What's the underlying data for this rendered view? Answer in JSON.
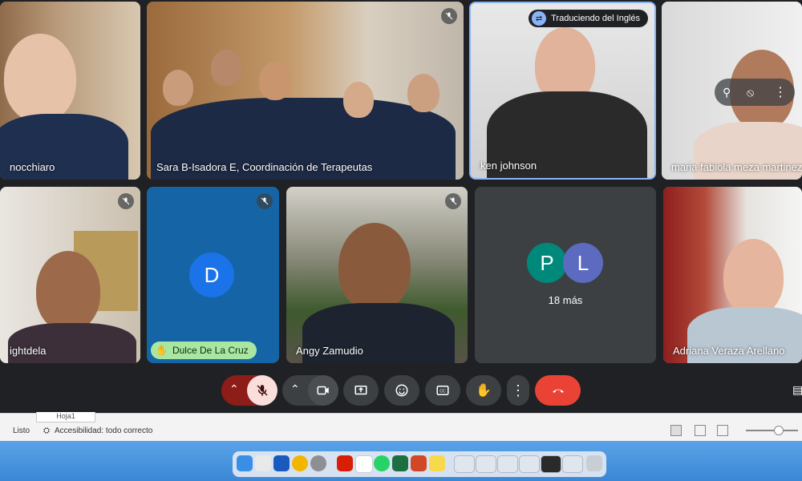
{
  "meeting": {
    "participants": [
      {
        "name": "nocchiaro"
      },
      {
        "name": "Sara B-Isadora E, Coordinación de Terapeutas"
      },
      {
        "name": "ken johnson",
        "badge": "Traduciendo del Inglés"
      },
      {
        "name": "maria fabiola meza martinez"
      },
      {
        "name": "ightdela"
      },
      {
        "name": "Dulce De La Cruz",
        "avatar_letter": "D",
        "hand_raised": true
      },
      {
        "name": "Angy Zamudio"
      },
      {
        "name": "Adriana Veraza Arellano"
      }
    ],
    "overflow": {
      "letters": [
        "P",
        "L"
      ],
      "label": "18 más"
    }
  },
  "controls": {
    "items": [
      "chevron-up-icon",
      "mic-off-icon",
      "chevron-up-icon",
      "camera-icon",
      "present-icon",
      "emoji-icon",
      "captions-icon",
      "raise-hand-icon",
      "more-icon",
      "end-call-icon"
    ]
  },
  "statusbar": {
    "left": "Listo",
    "accessibility": "Accesibilidad: todo correcto",
    "sheet_tab": "Hoja1"
  },
  "colors": {
    "end_call": "#ea4335",
    "mic_muted": "#8c1d18",
    "avatar_d": "#1a73e8",
    "avatar_p": "#00897b",
    "avatar_l": "#5c6bc0",
    "hand_badge": "#a8e6a1"
  }
}
